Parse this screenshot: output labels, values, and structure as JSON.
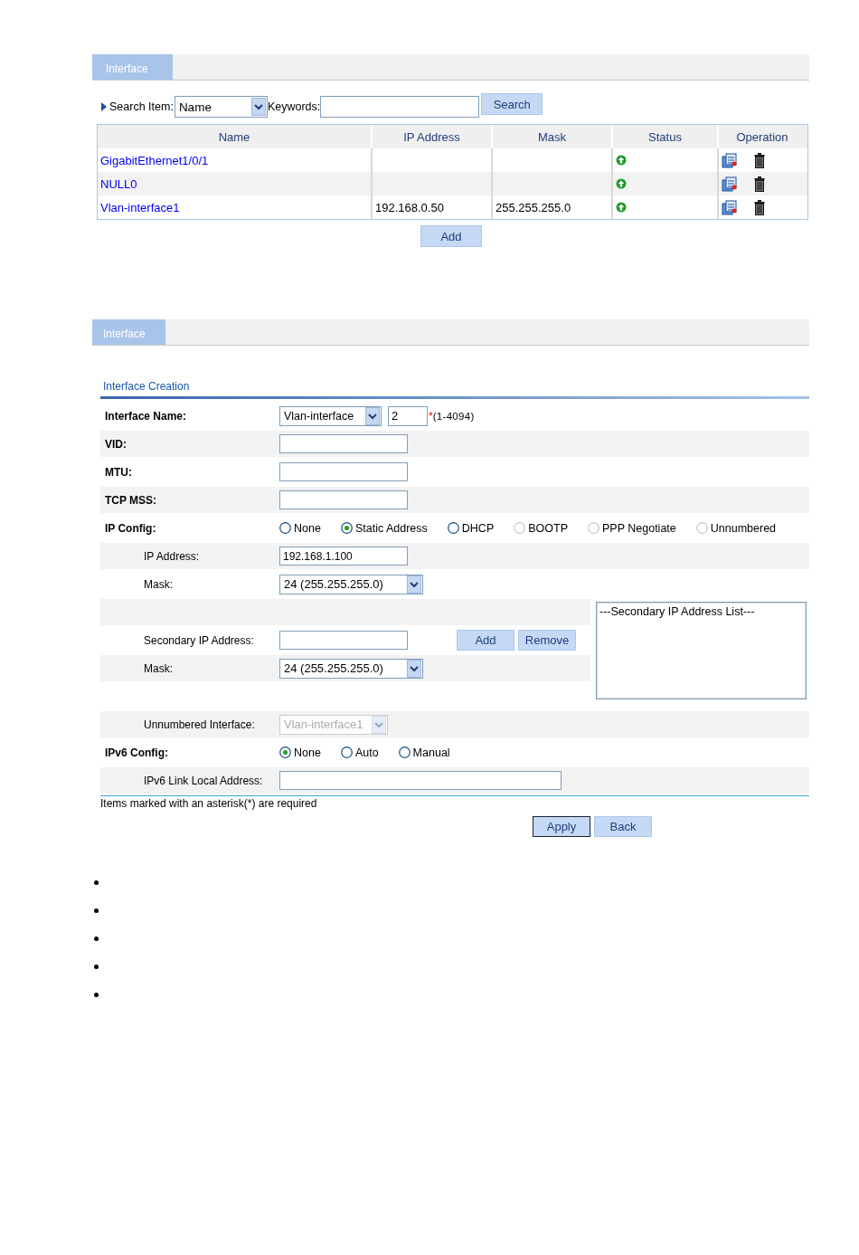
{
  "list_panel": {
    "tab": {
      "label": "Interface",
      "selected": true
    },
    "search": {
      "label": "Search Item:",
      "item": "Name",
      "keywords_label": "Keywords:",
      "button": "Search"
    },
    "table": {
      "columns": [
        "Name",
        "IP Address",
        "Mask",
        "Status",
        "Operation"
      ],
      "rows": [
        {
          "name": "GigabitEthernet1/0/1",
          "status_up": true
        },
        {
          "name": "NULL0",
          "status_up": true
        },
        {
          "name": "Vlan-interface1",
          "ip_address": "192.168.0.50",
          "mask": "255.255.255.0",
          "status_up": true
        }
      ]
    },
    "add_button": "Add"
  },
  "form_panel": {
    "tab": {
      "label": "Interface",
      "selected": true
    },
    "section_title": "Interface Creation",
    "rows": [
      {
        "kind": "name",
        "label": "Interface Name:",
        "select": "Vlan-interface",
        "value": "2",
        "required_mark": "*",
        "hint": "(1-4094)"
      },
      {
        "kind": "text",
        "label": "VID:"
      },
      {
        "kind": "text",
        "label": "MTU:"
      },
      {
        "kind": "text",
        "label": "TCP MSS:"
      },
      {
        "kind": "radio",
        "label": "IP Config:",
        "options": [
          {
            "label": "None",
            "selected": false,
            "disabled": false
          },
          {
            "label": "Static Address",
            "selected": true,
            "disabled": false
          },
          {
            "label": "DHCP",
            "selected": false,
            "disabled": false
          },
          {
            "label": "BOOTP",
            "selected": false,
            "disabled": true
          },
          {
            "label": "PPP Negotiate",
            "selected": false,
            "disabled": true
          },
          {
            "label": "Unnumbered",
            "selected": false,
            "disabled": true
          }
        ],
        "children": [
          {
            "kind": "text",
            "label": "IP Address:",
            "value": "192.168.1.100"
          },
          {
            "kind": "select",
            "label": "Mask:",
            "value": "24 (255.255.255.0)",
            "disabled": false
          },
          {
            "kind": "secondary",
            "label": "Secondary IP Address:",
            "buttons": [
              "Add",
              "Remove"
            ],
            "mask": {
              "label": "Mask:",
              "value": "24 (255.255.255.0)"
            },
            "list_header": "---Secondary IP Address List---"
          },
          {
            "kind": "select",
            "label": "Unnumbered Interface:",
            "value": "Vlan-interface1",
            "disabled": true
          }
        ]
      },
      {
        "kind": "radio",
        "label": "IPv6 Config:",
        "options": [
          {
            "label": "None",
            "selected": true,
            "disabled": false
          },
          {
            "label": "Auto",
            "selected": false,
            "disabled": false
          },
          {
            "label": "Manual",
            "selected": false,
            "disabled": false
          }
        ],
        "children": [
          {
            "kind": "long_text",
            "label": "IPv6 Link Local Address:"
          }
        ]
      }
    ],
    "note": "Items marked with an asterisk(*) are required",
    "buttons": [
      {
        "label": "Apply",
        "focused": true
      },
      {
        "label": "Back",
        "focused": false
      }
    ]
  }
}
